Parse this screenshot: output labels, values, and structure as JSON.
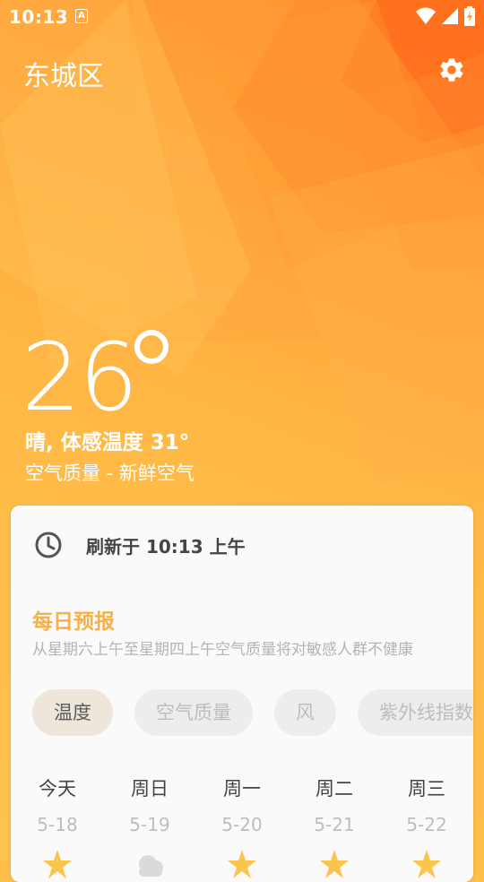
{
  "status_bar": {
    "time": "10:13",
    "notification_icon": "a-icon",
    "icons": [
      "wifi-icon",
      "signal-icon",
      "battery-charging-icon"
    ]
  },
  "header": {
    "city": "东城区",
    "settings_icon": "gear-icon"
  },
  "current": {
    "temperature": "26",
    "condition": "晴, 体感温度 31°",
    "air_quality": "空气质量 - 新鲜空气"
  },
  "card": {
    "refresh_text": "刷新于 10:13 上午",
    "daily_title": "每日预报",
    "daily_subtitle": "从星期六上午至星期四上午空气质量将对敏感人群不健康",
    "chips": [
      {
        "label": "温度",
        "active": true
      },
      {
        "label": "空气质量",
        "active": false
      },
      {
        "label": "风",
        "active": false
      },
      {
        "label": "紫外线指数",
        "active": false
      }
    ],
    "days": [
      {
        "name": "今天",
        "date": "5-18",
        "icon": "sun-icon"
      },
      {
        "name": "周日",
        "date": "5-19",
        "icon": "cloud-icon"
      },
      {
        "name": "周一",
        "date": "5-20",
        "icon": "sun-icon"
      },
      {
        "name": "周二",
        "date": "5-21",
        "icon": "sun-icon"
      },
      {
        "name": "周三",
        "date": "5-22",
        "icon": "sun-icon"
      }
    ]
  },
  "colors": {
    "accent": "#F5B14A",
    "background_top": "#FF8A2A",
    "background_bottom": "#FFC44E",
    "card": "#FAFAFA"
  }
}
